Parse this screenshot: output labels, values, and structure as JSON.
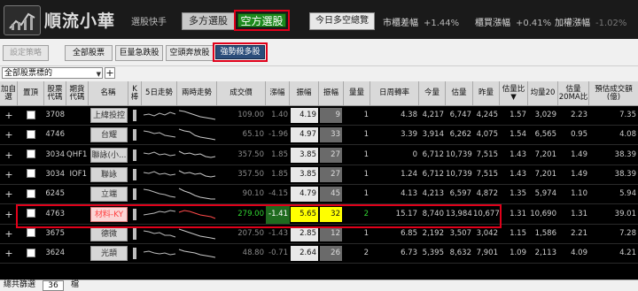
{
  "app": {
    "title": "順流小華",
    "subtitle": "選股快手"
  },
  "top_tabs": {
    "long": "多方選股",
    "short": "空方選股"
  },
  "summary_button": "今日多空總覽",
  "stats": [
    {
      "label": "市櫃差幅",
      "value": "+1.44%"
    },
    {
      "label": "櫃買漲幅",
      "value": "+0.41%"
    },
    {
      "label": "加權漲幅",
      "value": "-1.02%"
    }
  ],
  "toolbar": {
    "set_strategy": "設定策略",
    "all_stocks": "全部股票",
    "volume_surge": "巨量急跌股",
    "short_release": "空頭奔放股",
    "strong_short": "強勢殺多股"
  },
  "filter": {
    "selected": "全部股票標的"
  },
  "table": {
    "headers": {
      "add": "加自選",
      "top": "置頂",
      "code": "股票代碼",
      "futures": "期貨代碼",
      "name": "名稱",
      "k": "K棒",
      "trend5": "5日走勢",
      "intraday": "兩時走勢",
      "price": "成交價",
      "change": "漲幅",
      "amp": "振幅",
      "amp2": "振幅",
      "vol": "量量",
      "turnover": "日周轉率",
      "today": "今量",
      "est": "估量",
      "yday": "昨量",
      "est_ratio": "估量比▼",
      "avg20": "均量20",
      "est20": "估量20MA比",
      "est_amount": "預估成交額(億)"
    },
    "rows": [
      {
        "code": "3708",
        "fut": "",
        "name": "上緯投控",
        "price": "109.00",
        "chg": "1.40",
        "amp": "4.19",
        "amp2": "9",
        "vol": "1",
        "turnover": "4.38",
        "today": "4,217",
        "est": "6,747",
        "yday": "4,245",
        "est_ratio": "1.57",
        "avg20": "3,029",
        "est20": "2.23",
        "amount": "7.35"
      },
      {
        "code": "4746",
        "fut": "",
        "name": "台耀",
        "price": "65.10",
        "chg": "-1.96",
        "amp": "4.97",
        "amp2": "33",
        "vol": "1",
        "turnover": "3.39",
        "today": "3,914",
        "est": "6,262",
        "yday": "4,075",
        "est_ratio": "1.54",
        "avg20": "6,565",
        "est20": "0.95",
        "amount": "4.08"
      },
      {
        "code": "3034",
        "fut": "QHF1",
        "name": "聯詠(小...",
        "price": "357.50",
        "chg": "1.85",
        "amp": "3.85",
        "amp2": "27",
        "vol": "1",
        "turnover": "0",
        "today": "6,712",
        "est": "10,739",
        "yday": "7,515",
        "est_ratio": "1.43",
        "avg20": "7,201",
        "est20": "1.49",
        "amount": "38.39"
      },
      {
        "code": "3034",
        "fut": "IOF1",
        "name": "聯詠",
        "price": "357.50",
        "chg": "1.85",
        "amp": "3.85",
        "amp2": "27",
        "vol": "1",
        "turnover": "1.24",
        "today": "6,712",
        "est": "10,739",
        "yday": "7,515",
        "est_ratio": "1.43",
        "avg20": "7,201",
        "est20": "1.49",
        "amount": "38.39"
      },
      {
        "code": "6245",
        "fut": "",
        "name": "立端",
        "price": "90.10",
        "chg": "-4.15",
        "amp": "4.79",
        "amp2": "45",
        "vol": "1",
        "turnover": "4.13",
        "today": "4,213",
        "est": "6,597",
        "yday": "4,872",
        "est_ratio": "1.35",
        "avg20": "5,974",
        "est20": "1.10",
        "amount": "5.94"
      },
      {
        "code": "4763",
        "fut": "",
        "name": "材料-KY",
        "price": "279.00",
        "chg": "-1.41",
        "amp": "5.65",
        "amp2": "32",
        "vol": "2",
        "turnover": "15.17",
        "today": "8,740",
        "est": "13,984",
        "yday": "10,677",
        "est_ratio": "1.31",
        "avg20": "10,690",
        "est20": "1.31",
        "amount": "39.01",
        "highlight": true
      },
      {
        "code": "3675",
        "fut": "",
        "name": "德微",
        "price": "207.50",
        "chg": "-1.43",
        "amp": "2.85",
        "amp2": "12",
        "vol": "1",
        "turnover": "6.85",
        "today": "2,192",
        "est": "3,507",
        "yday": "3,042",
        "est_ratio": "1.15",
        "avg20": "1,586",
        "est20": "2.21",
        "amount": "7.28"
      },
      {
        "code": "3624",
        "fut": "",
        "name": "光頡",
        "price": "48.80",
        "chg": "-0.71",
        "amp": "2.64",
        "amp2": "26",
        "vol": "2",
        "turnover": "6.73",
        "today": "5,395",
        "est": "8,632",
        "yday": "7,901",
        "est_ratio": "1.09",
        "avg20": "2,113",
        "est20": "4.09",
        "amount": "4.21"
      }
    ]
  },
  "footer": {
    "label": "總共篩選",
    "count": "36",
    "unit": "檔"
  }
}
